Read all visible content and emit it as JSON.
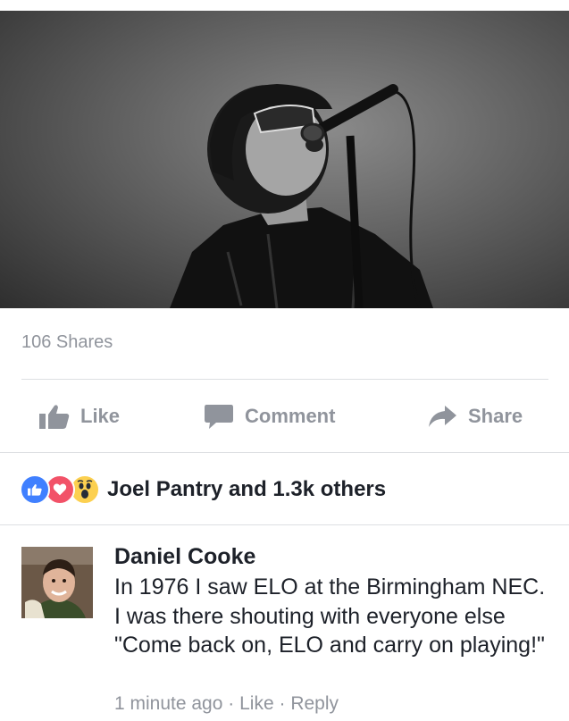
{
  "post": {
    "shares_text": "106 Shares"
  },
  "actions": {
    "like_label": "Like",
    "comment_label": "Comment",
    "share_label": "Share"
  },
  "reactions": {
    "icons": [
      "like-reaction",
      "love-reaction",
      "wow-reaction"
    ],
    "summary": "Joel Pantry and 1.3k others"
  },
  "comment": {
    "author": "Daniel Cooke",
    "text": "In 1976 I saw ELO at the Birmingham NEC. I was there shouting with everyone else \"Come back on, ELO and carry on playing!\"",
    "time": "1 minute ago",
    "separator": "·",
    "like_label": "Like",
    "reply_label": "Reply"
  },
  "colors": {
    "text_primary": "#1d2129",
    "text_secondary": "#90949c",
    "like_blue": "#4080ff",
    "love_red": "#f25268",
    "wow_yellow": "#fcd050",
    "divider": "#dddfe2"
  }
}
